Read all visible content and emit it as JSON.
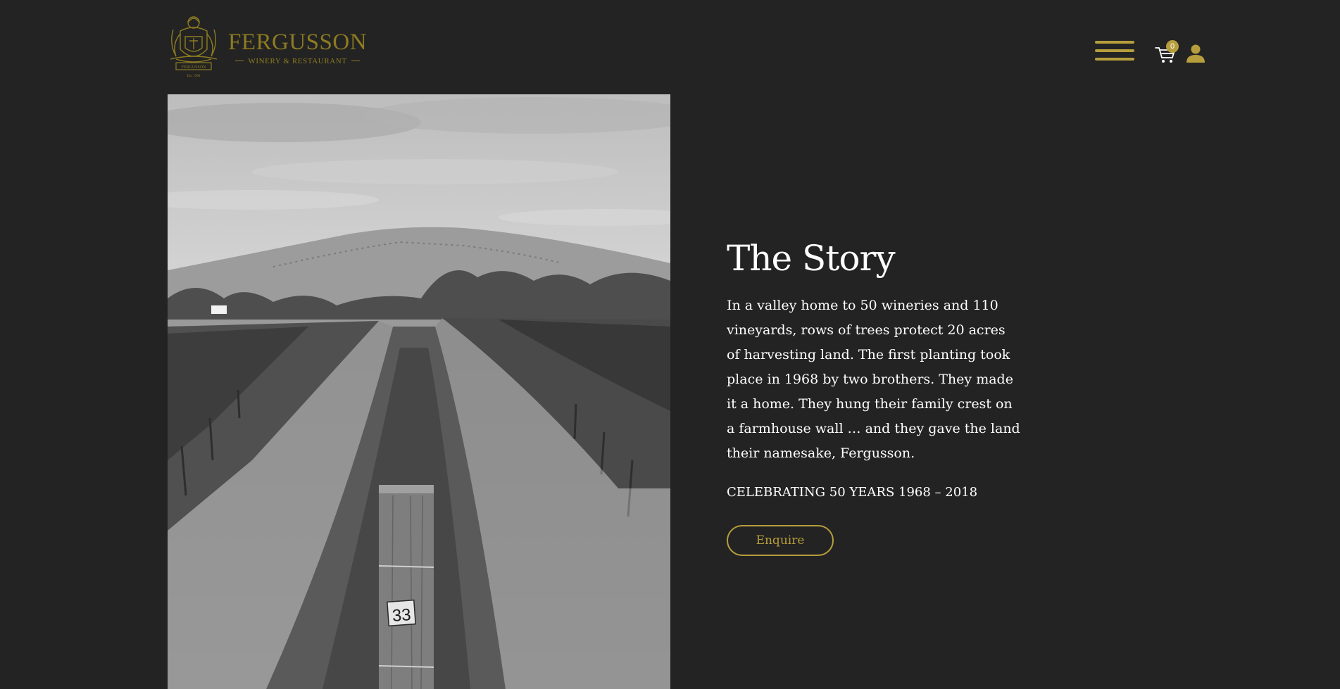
{
  "brand": {
    "name": "FERGUSSON",
    "tagline": "WINERY & RESTAURANT",
    "crest_text": "FERGUSSON",
    "crest_est": "Est. 1968"
  },
  "header": {
    "menu_icon": "hamburger-icon",
    "cart_icon": "cart-icon",
    "cart_count": "0",
    "account_icon": "user-icon"
  },
  "hero": {
    "image_description": "black and white vineyard rows leading to hill",
    "post_number": "33"
  },
  "story": {
    "title": "The Story",
    "body": "In a valley home to 50 wineries and 110 vineyards, rows of trees protect 20 acres of harvesting land. The first planting took place in 1968 by two brothers. They made it a home. They hung their family crest on a farmhouse wall … and they gave the land their namesake, Fergusson.",
    "celebrating": "CELEBRATING 50 YEARS 1968 – 2018",
    "cta_label": "Enquire"
  },
  "colors": {
    "background": "#232323",
    "accent": "#b69e3c",
    "logo": "#8d7b22",
    "text": "#ffffff"
  }
}
